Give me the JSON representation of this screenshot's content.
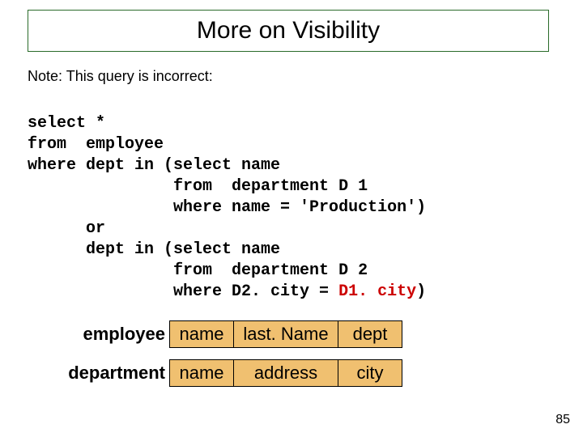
{
  "title": "More on Visibility",
  "note": "Note: This query is incorrect:",
  "code": {
    "l1": "select *",
    "l2": "from  employee",
    "l3": "where dept in (select name",
    "l4": "               from  department D 1",
    "l5": "               where name = 'Production')",
    "l6": "      or",
    "l7": "      dept in (select name",
    "l8": "               from  department D 2",
    "l9a": "               where D2. city = ",
    "l9b": "D1. city",
    "l9c": ")"
  },
  "tables": {
    "employee": {
      "label": "employee",
      "cols": [
        "name",
        "last. Name",
        "dept"
      ]
    },
    "department": {
      "label": "department",
      "cols": [
        "name",
        "address",
        "city"
      ]
    }
  },
  "page_number": "85"
}
